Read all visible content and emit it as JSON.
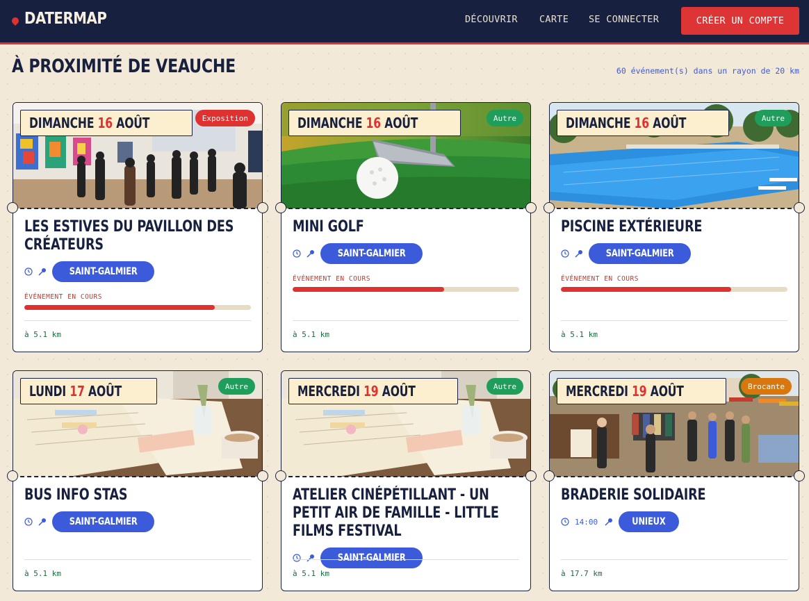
{
  "brand": {
    "name": "DATERMAP"
  },
  "nav": {
    "discover": "DÉCOUVRIR",
    "map": "CARTE",
    "login": "SE CONNECTER",
    "signup": "CRÉER UN COMPTE"
  },
  "section": {
    "title": "À PROXIMITÉ DE VEAUCHE",
    "count": "60 événement(s) dans un rayon de 20 km"
  },
  "colors": {
    "navy": "#17203f",
    "accent_red": "#e03131",
    "blue": "#3b5bdb",
    "green": "#1e9e5a",
    "orange": "#d9770f"
  },
  "events": [
    {
      "weekday": "DIMANCHE",
      "day": "16",
      "month": "AOÛT",
      "category": "Exposition",
      "category_color": "#e03131",
      "title": "LES ESTIVES DU PAVILLON DES CRÉATEURS",
      "time": "",
      "city": "SAINT-GALMIER",
      "status": "ÉVÉNEMENT EN COURS",
      "progress": 0.84,
      "distance": "à 5.1 km",
      "image": "gallery"
    },
    {
      "weekday": "DIMANCHE",
      "day": "16",
      "month": "AOÛT",
      "category": "Autre",
      "category_color": "#1e9e5a",
      "title": "MINI GOLF",
      "time": "",
      "city": "SAINT-GALMIER",
      "status": "ÉVÉNEMENT EN COURS",
      "progress": 0.67,
      "distance": "à 5.1 km",
      "image": "golf"
    },
    {
      "weekday": "DIMANCHE",
      "day": "16",
      "month": "AOÛT",
      "category": "Autre",
      "category_color": "#1e9e5a",
      "title": "PISCINE EXTÉRIEURE",
      "time": "",
      "city": "SAINT-GALMIER",
      "status": "ÉVÉNEMENT EN COURS",
      "progress": 0.75,
      "distance": "à 5.1 km",
      "image": "pool"
    },
    {
      "weekday": "LUNDI",
      "day": "17",
      "month": "AOÛT",
      "category": "Autre",
      "category_color": "#1e9e5a",
      "title": "BUS INFO STAS",
      "time": "",
      "city": "SAINT-GALMIER",
      "status": "",
      "progress": null,
      "distance": "à 5.1 km",
      "image": "notebook"
    },
    {
      "weekday": "MERCREDI",
      "day": "19",
      "month": "AOÛT",
      "category": "Autre",
      "category_color": "#1e9e5a",
      "title": "ATELIER CINÉPÉTILLANT - UN PETIT AIR DE FAMILLE - LITTLE FILMS FESTIVAL",
      "time": "",
      "city": "SAINT-GALMIER",
      "status": "",
      "progress": null,
      "distance": "à 5.1 km",
      "image": "notebook"
    },
    {
      "weekday": "MERCREDI",
      "day": "19",
      "month": "AOÛT",
      "category": "Brocante",
      "category_color": "#d9770f",
      "title": "BRADERIE SOLIDAIRE",
      "time": "14:00",
      "city": "UNIEUX",
      "status": "",
      "progress": null,
      "distance": "à 17.7 km",
      "image": "market"
    }
  ]
}
